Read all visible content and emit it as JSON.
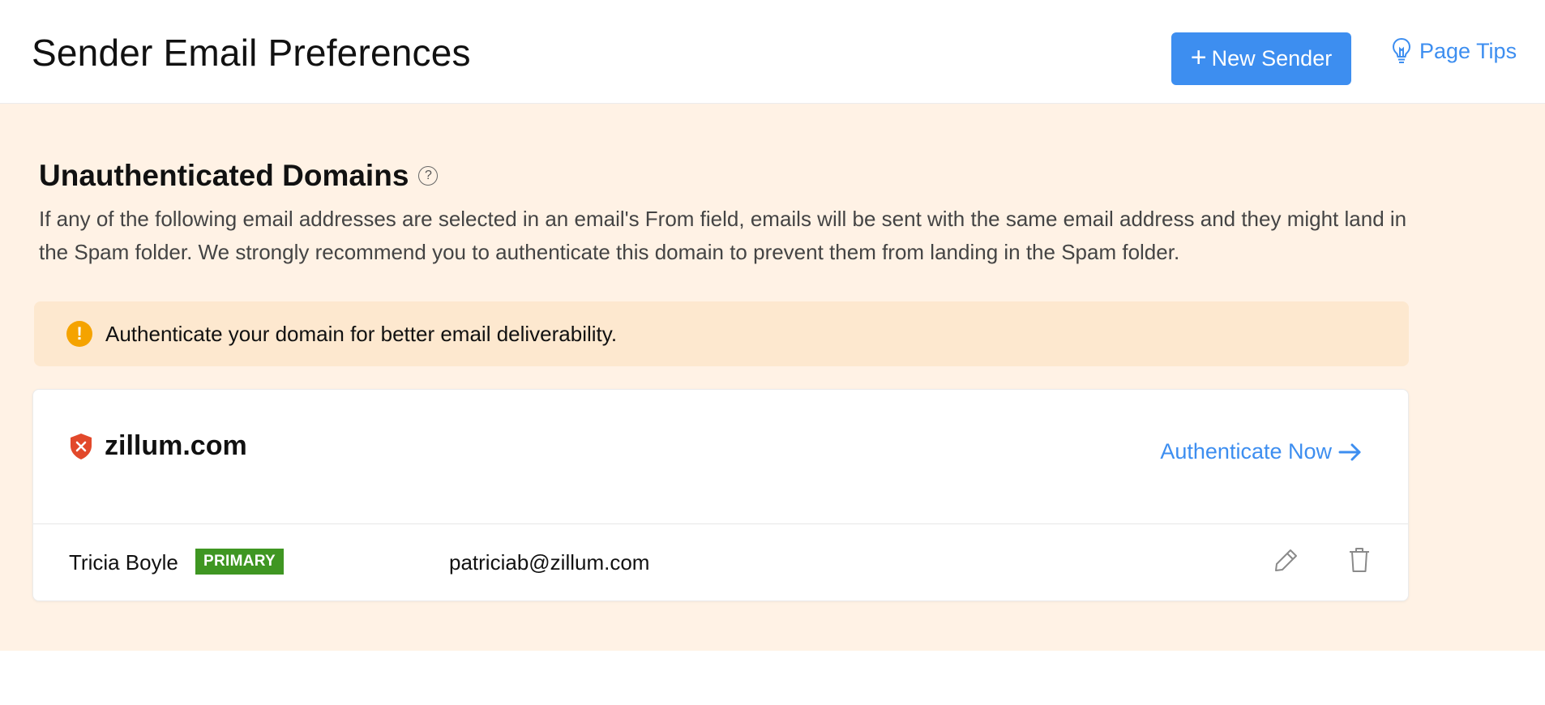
{
  "header": {
    "title": "Sender Email Preferences",
    "new_sender_label": "New Sender",
    "page_tips_label": "Page Tips"
  },
  "section": {
    "title": "Unauthenticated Domains",
    "help_glyph": "?",
    "description": "If any of the following email addresses are selected in an email's From field, emails will be sent with the same email address and they might land in the Spam folder. We strongly recommend you to authenticate this domain to prevent them from landing in the Spam folder."
  },
  "alert": {
    "glyph": "!",
    "text": "Authenticate your domain for better email deliverability."
  },
  "domain_card": {
    "domain": "zillum.com",
    "status_icon": "shield-x-icon",
    "action_label": "Authenticate Now",
    "senders": [
      {
        "name": "Tricia Boyle",
        "badge": "PRIMARY",
        "email": "patriciab@zillum.com"
      }
    ]
  },
  "colors": {
    "accent": "#3d8ef0",
    "warning_bg": "#fff2e5",
    "alert_bg": "#fde8cf",
    "alert_icon": "#f5a300",
    "badge_green": "#3f9622",
    "shield_red": "#e2492b"
  }
}
